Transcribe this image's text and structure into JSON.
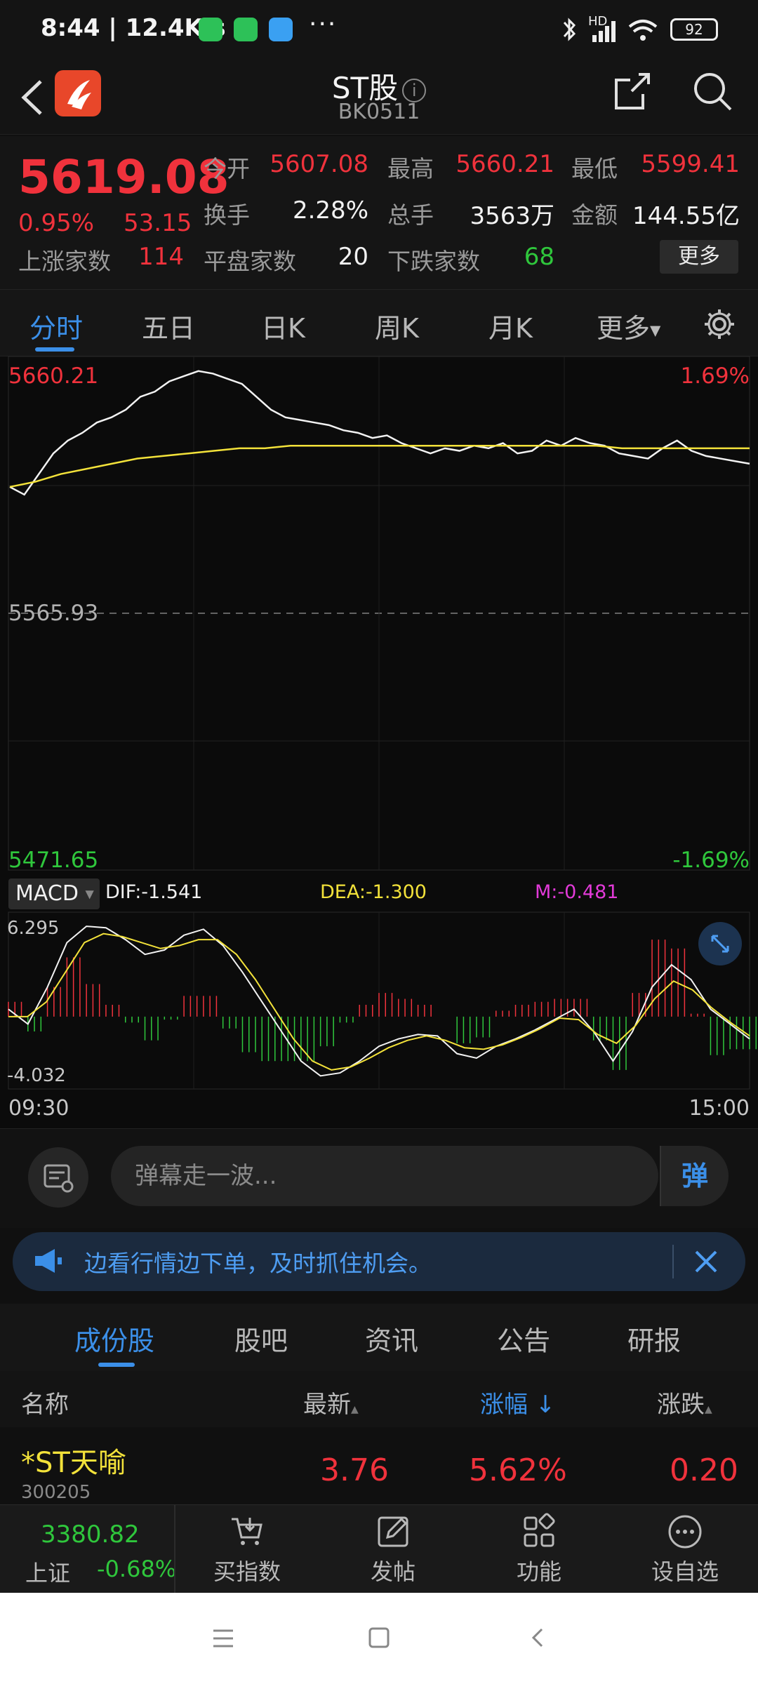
{
  "status_bar": {
    "time": "8:44 | 12.4K/s",
    "more": "···",
    "signal": "HD",
    "battery": "92"
  },
  "header": {
    "title": "ST股",
    "info_glyph": "i",
    "code": "BK0511"
  },
  "quote": {
    "price": "5619.08",
    "change_pct": "0.95%",
    "change_val": "53.15",
    "open_label": "今开",
    "open": "5607.08",
    "high_label": "最高",
    "high": "5660.21",
    "low_label": "最低",
    "low": "5599.41",
    "turnover_label": "换手",
    "turnover": "2.28%",
    "volume_label": "总手",
    "volume": "3563万",
    "amount_label": "金额",
    "amount": "144.55亿",
    "up_label": "上涨家数",
    "up": "114",
    "flat_label": "平盘家数",
    "flat": "20",
    "down_label": "下跌家数",
    "down": "68",
    "more_button": "更多"
  },
  "tabs": [
    "分时",
    "五日",
    "日K",
    "周K",
    "月K",
    "更多"
  ],
  "chart": {
    "top_price": "5660.21",
    "top_pct": "1.69%",
    "mid_price": "5565.93",
    "bottom_price": "5471.65",
    "bottom_pct": "-1.69%",
    "macd_button": "MACD",
    "dif": "DIF:-1.541",
    "dea": "DEA:-1.300",
    "m": "M:-0.481",
    "macd_top": "6.295",
    "macd_bottom": "-4.032",
    "time_start": "09:30",
    "time_end": "15:00"
  },
  "chart_data": {
    "type": "line",
    "title": "",
    "ylim": [
      5471.65,
      5660.21
    ],
    "series": [
      {
        "values": [
          5615,
          5612,
          5620,
          5628,
          5633,
          5636,
          5640,
          5642,
          5645,
          5650,
          5652,
          5656,
          5658,
          5660,
          5659,
          5657,
          5655,
          5650,
          5645,
          5642,
          5641,
          5640,
          5639,
          5637,
          5636,
          5634,
          5635,
          5632,
          5630,
          5628,
          5630,
          5629,
          5631,
          5630,
          5632,
          5628,
          5629,
          5633,
          5631,
          5634,
          5632,
          5631,
          5628,
          5627,
          5626,
          5630,
          5633,
          5629,
          5627,
          5626,
          5625,
          5624
        ]
      },
      {
        "values": [
          5615,
          5617,
          5620,
          5622,
          5624,
          5626,
          5627,
          5628,
          5629,
          5630,
          5630,
          5631,
          5631,
          5631,
          5631,
          5631,
          5631,
          5631,
          5631,
          5631,
          5631,
          5631,
          5631,
          5631,
          5630,
          5630,
          5630,
          5630,
          5630,
          5630
        ]
      }
    ],
    "macd": {
      "ylim": [
        -4.032,
        6.295
      ],
      "dif": [
        0.5,
        -0.5,
        2,
        5,
        6.1,
        6,
        5.2,
        4.2,
        4.5,
        5.5,
        5.9,
        4.8,
        3,
        1,
        -1,
        -3,
        -4,
        -3.8,
        -3,
        -2,
        -1.5,
        -1.2,
        -1.3,
        -2.5,
        -2.8,
        -2,
        -1.5,
        -0.9,
        -0.2,
        0.5,
        -1,
        -3,
        -1,
        2,
        3.5,
        2.5,
        0.5,
        -0.5,
        -1.5
      ],
      "dea": [
        0,
        0,
        1,
        3,
        5,
        5.6,
        5.4,
        5,
        4.6,
        4.8,
        5.2,
        5.2,
        4.2,
        2.5,
        0.5,
        -1.5,
        -3,
        -3.6,
        -3.4,
        -2.8,
        -2.1,
        -1.6,
        -1.3,
        -1.6,
        -2.1,
        -2.2,
        -1.9,
        -1.4,
        -0.8,
        -0.1,
        -0.2,
        -1.2,
        -1.8,
        -0.6,
        1.2,
        2.4,
        1.8,
        0.6,
        -0.4,
        -1.3
      ]
    }
  },
  "danmu": {
    "placeholder": "弹幕走一波...",
    "send": "弹"
  },
  "promo": {
    "text": "边看行情边下单，及时抓住机会。"
  },
  "subtabs": [
    "成份股",
    "股吧",
    "资讯",
    "公告",
    "研报"
  ],
  "table": {
    "headers": {
      "name": "名称",
      "last": "最新",
      "pct": "涨幅",
      "pct_arrow": "↓",
      "chg": "涨跌"
    },
    "rows": [
      {
        "name": "*ST天喻",
        "code": "300205",
        "last": "3.76",
        "pct": "5.62%",
        "chg": "0.20"
      }
    ]
  },
  "bottom_nav": {
    "index_value": "3380.82",
    "index_name": "上证",
    "index_change": "-0.68%",
    "items": [
      "买指数",
      "发帖",
      "功能",
      "设自选"
    ]
  },
  "colors": {
    "up": "#f0323c",
    "down": "#2fc73c",
    "accent": "#3b8fe8",
    "avg_line": "#f3e23a"
  }
}
